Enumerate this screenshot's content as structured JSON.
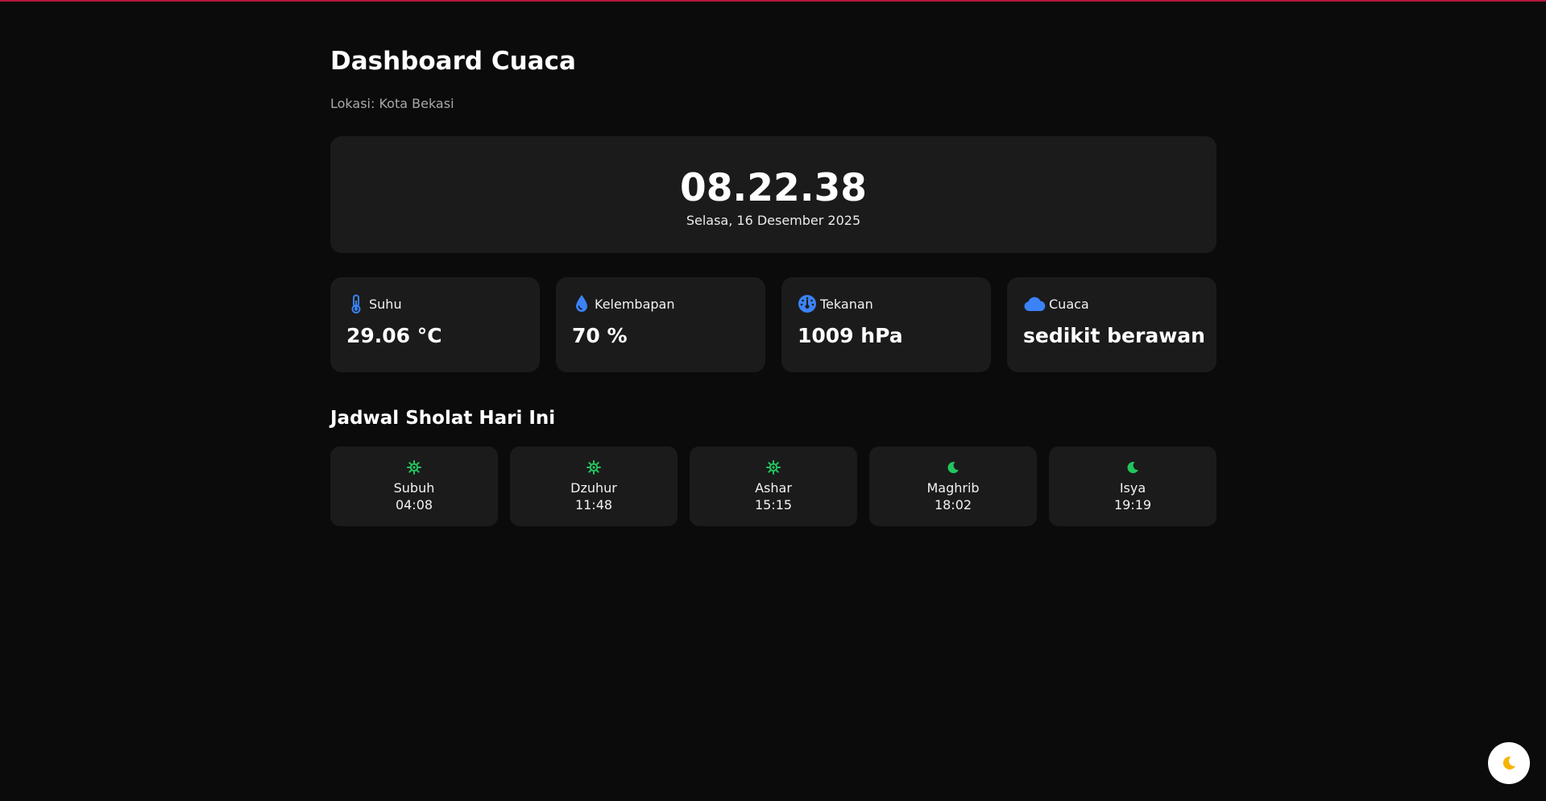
{
  "header": {
    "title": "Dashboard Cuaca",
    "location": "Lokasi: Kota Bekasi"
  },
  "clock": {
    "time": "08.22.38",
    "date": "Selasa, 16 Desember 2025"
  },
  "stats": [
    {
      "label": "Suhu",
      "value": "29.06 °C",
      "icon": "thermometer-icon"
    },
    {
      "label": "Kelembapan",
      "value": "70 %",
      "icon": "droplet-icon"
    },
    {
      "label": "Tekanan",
      "value": "1009 hPa",
      "icon": "gauge-icon"
    },
    {
      "label": "Cuaca",
      "value": "sedikit berawan",
      "icon": "cloud-icon"
    }
  ],
  "prayer": {
    "title": "Jadwal Sholat Hari Ini",
    "items": [
      {
        "name": "Subuh",
        "time": "04:08",
        "icon": "sun-icon"
      },
      {
        "name": "Dzuhur",
        "time": "11:48",
        "icon": "sun-icon"
      },
      {
        "name": "Ashar",
        "time": "15:15",
        "icon": "sun-icon"
      },
      {
        "name": "Maghrib",
        "time": "18:02",
        "icon": "moon-icon"
      },
      {
        "name": "Isya",
        "time": "19:19",
        "icon": "moon-icon"
      }
    ]
  },
  "theme_toggle": {
    "icon": "crescent-moon-icon"
  },
  "colors": {
    "background": "#0b0b0b",
    "card": "#1b1b1b",
    "stat_icon": "#3b82f6",
    "prayer_icon": "#22c55e",
    "top_border": "#b0173a"
  }
}
